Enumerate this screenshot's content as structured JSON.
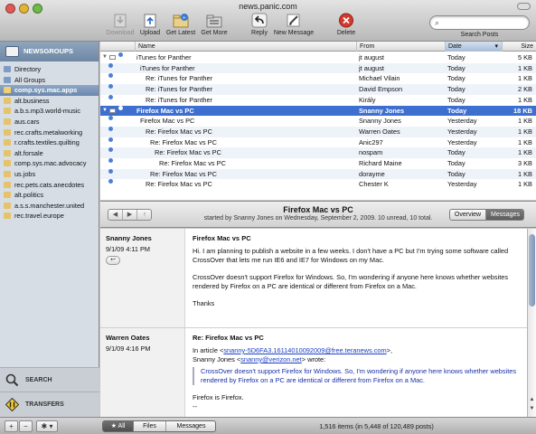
{
  "window": {
    "title": "news.panic.com"
  },
  "toolbar": {
    "download": "Download",
    "upload": "Upload",
    "get_latest": "Get Latest",
    "get_more": "Get More",
    "reply": "Reply",
    "new_message": "New Message",
    "delete": "Delete",
    "search_placeholder": "",
    "search_label": "Search Posts"
  },
  "sidebar": {
    "header": "NEWSGROUPS",
    "items": [
      "Directory",
      "All Groups",
      "comp.sys.mac.apps",
      "alt.business",
      "a.b.s.mp3.world-music",
      "aus.cars",
      "rec.crafts.metalworking",
      "r.crafts.textiles.quilting",
      "alt.forsale",
      "comp.sys.mac.advocacy",
      "us.jobs",
      "rec.pets.cats.anecdotes",
      "alt.politics",
      "a.s.s.manchester.united",
      "rec.travel.europe"
    ],
    "search_label": "SEARCH",
    "transfers_label": "TRANSFERS"
  },
  "list": {
    "columns": {
      "name": "Name",
      "from": "From",
      "date": "Date",
      "size": "Size"
    },
    "rows": [
      {
        "name": "iTunes for Panther",
        "from": "jt august",
        "date": "Today",
        "size": "5 KB"
      },
      {
        "name": "iTunes for Panther",
        "from": "jt august",
        "date": "Today",
        "size": "1 KB"
      },
      {
        "name": "Re: iTunes for Panther",
        "from": "Michael Vilain",
        "date": "Today",
        "size": "1 KB"
      },
      {
        "name": "Re: iTunes for Panther",
        "from": "David Empson",
        "date": "Today",
        "size": "2 KB"
      },
      {
        "name": "Re: iTunes for Panther",
        "from": "Király",
        "date": "Today",
        "size": "1 KB"
      },
      {
        "name": "Firefox Mac vs PC",
        "from": "Snanny Jones",
        "date": "Today",
        "size": "18 KB"
      },
      {
        "name": "Firefox Mac vs PC",
        "from": "Snanny Jones",
        "date": "Yesterday",
        "size": "1 KB"
      },
      {
        "name": "Re: Firefox Mac vs PC",
        "from": "Warren Oates",
        "date": "Yesterday",
        "size": "1 KB"
      },
      {
        "name": "Re: Firefox Mac vs PC",
        "from": "Anic297",
        "date": "Yesterday",
        "size": "1 KB"
      },
      {
        "name": "Re: Firefox Mac vs PC",
        "from": "nospam",
        "date": "Today",
        "size": "1 KB"
      },
      {
        "name": "Re: Firefox Mac vs PC",
        "from": "Richard Maine",
        "date": "Today",
        "size": "3 KB"
      },
      {
        "name": "Re: Firefox Mac vs PC",
        "from": "dorayme",
        "date": "Today",
        "size": "1 KB"
      },
      {
        "name": "Re: Firefox Mac vs PC",
        "from": "Chester K",
        "date": "Yesterday",
        "size": "1 KB"
      }
    ]
  },
  "thread": {
    "title": "Firefox Mac vs PC",
    "subtitle": "started by Snanny Jones on Wednesday, September 2, 2009. 10 unread, 10 total.",
    "overview": "Overview",
    "messages": "Messages"
  },
  "messages": [
    {
      "from": "Snanny Jones",
      "date": "9/1/09 4:11 PM",
      "subject": "Firefox Mac vs PC",
      "p1": "Hi. I am planning to publish a website in a few weeks. I don't have a PC but I'm trying some software called CrossOver that lets me run IE6 and IE7 for Windows on my Mac.",
      "p2": "CrossOver doesn't support Firefox for Windows. So, I'm wondering if anyone here knows whether websites rendered by Firefox on a PC are identical or different from Firefox on a Mac.",
      "p3": "Thanks"
    },
    {
      "from": "Warren Oates",
      "date": "9/1/09 4:16 PM",
      "subject": "Re: Firefox Mac vs PC",
      "in_article": "In article <",
      "ref_link": "snanny-5D6FA3.16114010092009@free.teranews.com",
      "ref_end": ">,",
      "author": " Snanny Jones <",
      "author_link": "snanny@verizon.net",
      "wrote": "> wrote:",
      "quote": "CrossOver doesn't support Firefox for Windows. So, I'm wondering if anyone here knows whether websites rendered by Firefox on a PC are identical or different from Firefox on a Mac.",
      "reply": "Firefox is Firefox.",
      "sig": "--"
    }
  ],
  "statusbar": {
    "add": "+",
    "remove": "−",
    "gear": "✱",
    "filters": [
      "★ All",
      "Files",
      "Messages"
    ],
    "status": "1,516 items (in 5,448 of 120,489 posts)"
  },
  "colors": {
    "selection": "#3d6fd0",
    "unread_dot": "#4c7fd6",
    "link": "#1a3fc4",
    "sidebar_bg": "#d6dde5"
  }
}
